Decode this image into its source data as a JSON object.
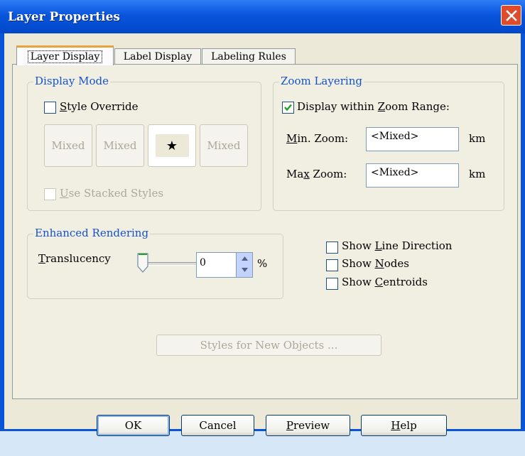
{
  "window": {
    "title": "Layer Properties"
  },
  "tabs": [
    {
      "label": "Layer Display",
      "active": true
    },
    {
      "label": "Label Display",
      "active": false
    },
    {
      "label": "Labeling Rules",
      "active": false
    }
  ],
  "display_mode": {
    "title": "Display Mode",
    "style_override": {
      "label_pre": "",
      "label_u": "S",
      "label_post": "tyle Override",
      "checked": false
    },
    "style_buttons": [
      "Mixed",
      "Mixed",
      "★",
      "Mixed"
    ],
    "use_stacked": {
      "label_u": "U",
      "label_post": "se Stacked Styles",
      "checked": false,
      "disabled": true
    }
  },
  "zoom_layering": {
    "title": "Zoom Layering",
    "display_within": {
      "label_pre": "Display within ",
      "label_u": "Z",
      "label_post": "oom Range:",
      "checked": true
    },
    "min_zoom": {
      "label_u": "M",
      "label_post": "in. Zoom:",
      "value": "<Mixed>",
      "unit": "km"
    },
    "max_zoom": {
      "label_pre": "Ma",
      "label_u": "x",
      "label_post": " Zoom:",
      "value": "<Mixed>",
      "unit": "km"
    }
  },
  "enhanced_rendering": {
    "title": "Enhanced Rendering",
    "translucency": {
      "label_u": "T",
      "label_post": "ranslucency",
      "value": "0",
      "unit": "%",
      "slider_fraction": 0
    }
  },
  "options": [
    {
      "label_pre": "Show ",
      "label_u": "L",
      "label_post": "ine Direction",
      "checked": false
    },
    {
      "label_pre": "Show ",
      "label_u": "N",
      "label_post": "odes",
      "checked": false
    },
    {
      "label_pre": "Show ",
      "label_u": "C",
      "label_post": "entroids",
      "checked": false
    }
  ],
  "styles_new_objects": "Styles for New Objects ...",
  "buttons": {
    "ok": "OK",
    "cancel": "Cancel",
    "preview_u": "P",
    "preview_post": "review",
    "help_u": "H",
    "help_post": "elp"
  },
  "colors": {
    "titlebar": "#0a55dc",
    "close": "#e04b2c",
    "group_title": "#1452cc",
    "check": "#21a121"
  }
}
